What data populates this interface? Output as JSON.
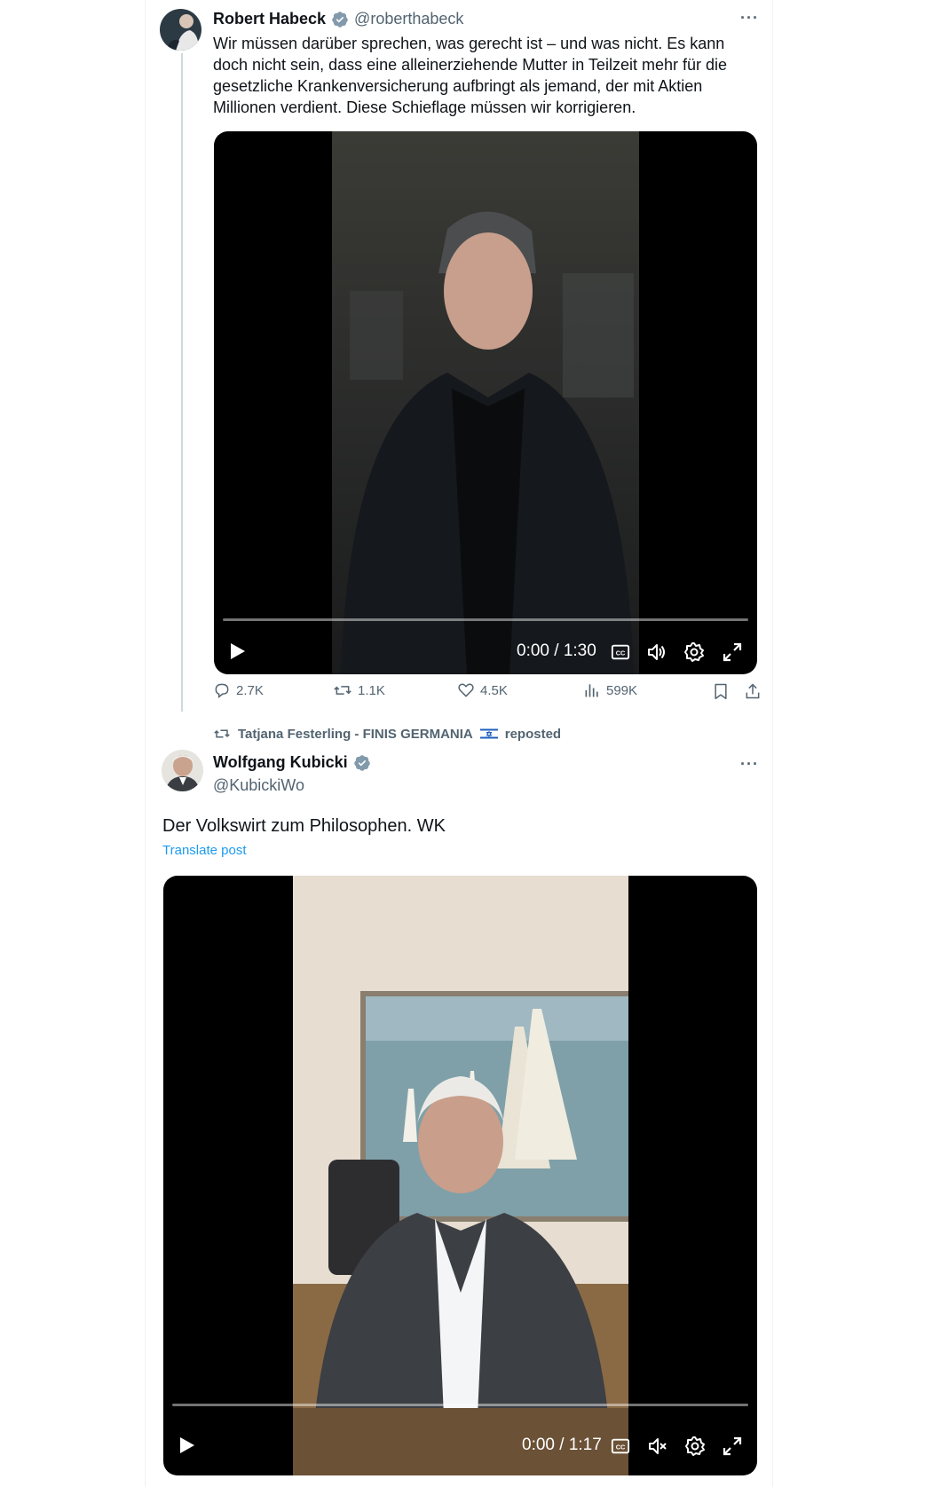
{
  "tweet1": {
    "author_name": "Robert Habeck",
    "author_handle": "@roberthabeck",
    "more_label": "···",
    "text": "Wir müssen darüber sprechen, was gerecht ist – und was nicht. Es kann doch nicht sein, dass eine alleinerziehende Mutter in Teilzeit mehr für die gesetzliche Krankenversicherung aufbringt als jemand, der mit Aktien Millionen verdient. Diese Schieflage müssen wir korrigieren.",
    "video": {
      "time": "0:00 / 1:30",
      "progress": 0,
      "muted": false
    },
    "stats": {
      "replies": "2.7K",
      "reposts": "1.1K",
      "likes": "4.5K",
      "views": "599K"
    }
  },
  "repost": {
    "reposter": "Tatjana Festerling - FINIS GERMANIA",
    "suffix": "reposted"
  },
  "tweet2": {
    "author_name": "Wolfgang Kubicki",
    "author_handle": "@KubickiWo",
    "more_label": "···",
    "text": "Der Volkswirt zum Philosophen. WK",
    "translate": "Translate post",
    "video": {
      "time": "0:00 / 1:17",
      "progress": 0,
      "muted": true
    }
  },
  "colors": {
    "verified": "#829aab",
    "link": "#1d9bf0",
    "secondary_text": "#536471"
  }
}
